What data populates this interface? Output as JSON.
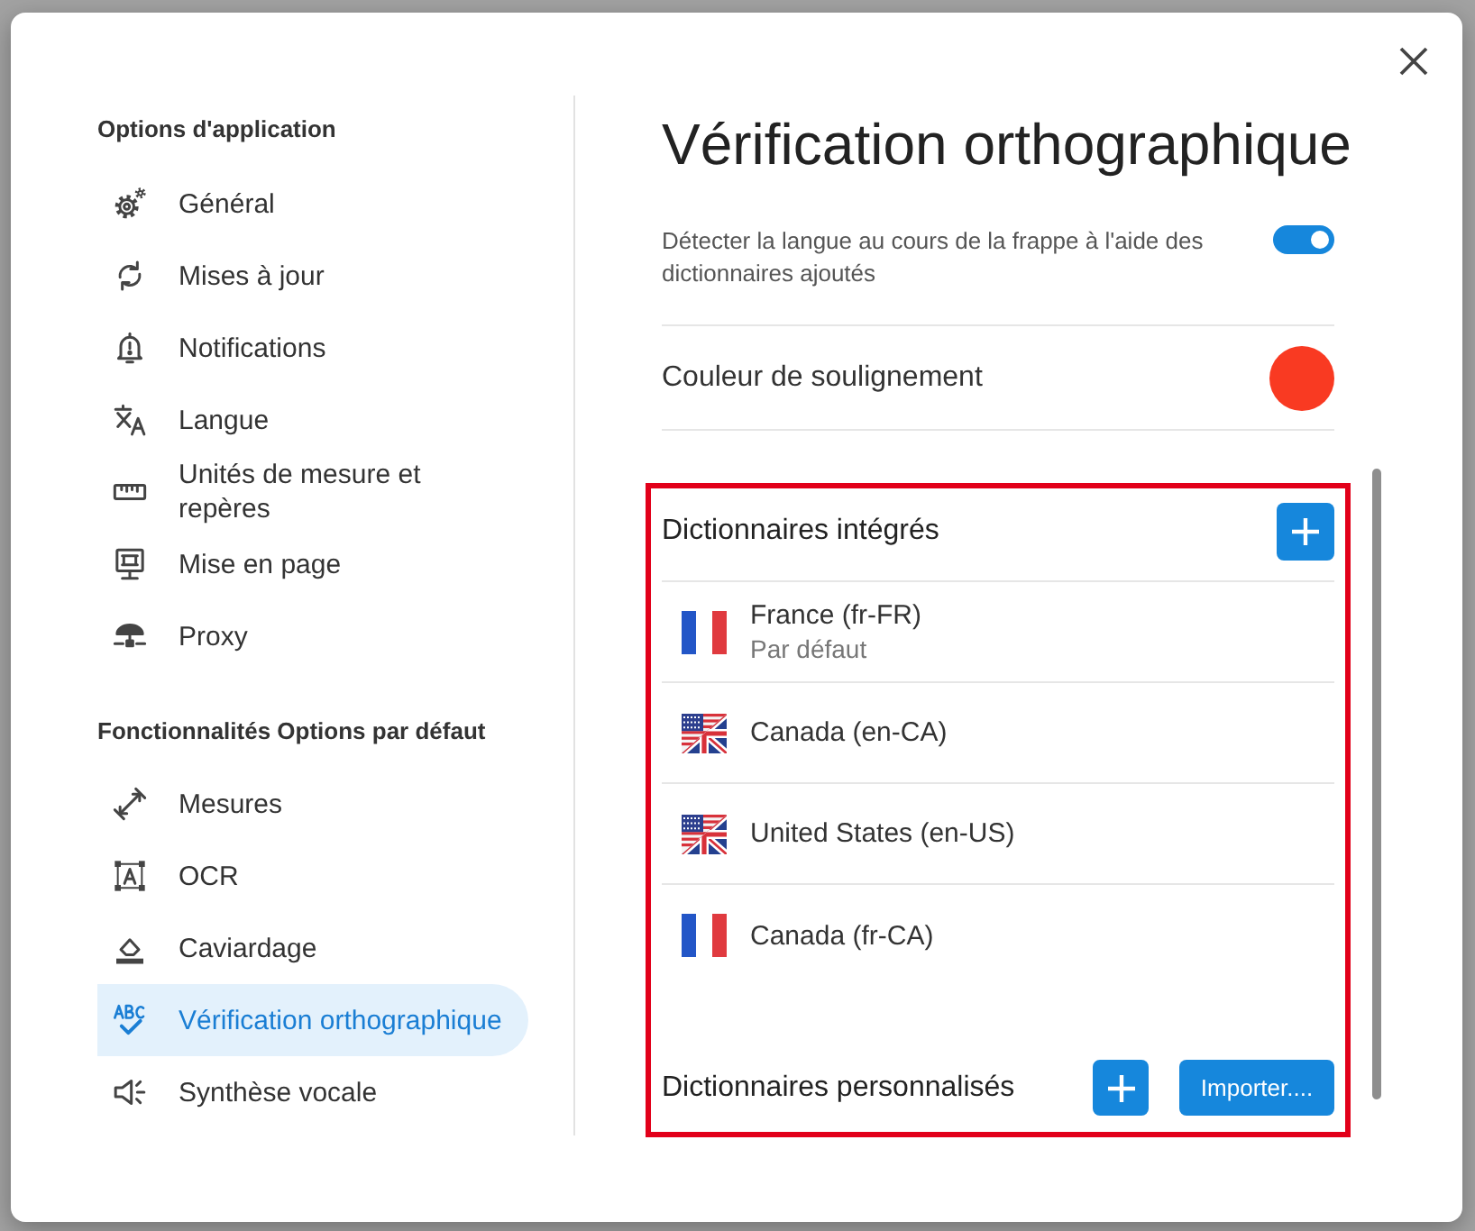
{
  "sidebar": {
    "sections": [
      {
        "title": "Options d'application",
        "items": [
          {
            "label": "Général",
            "selected": false
          },
          {
            "label": "Mises à jour",
            "selected": false
          },
          {
            "label": "Notifications",
            "selected": false
          },
          {
            "label": "Langue",
            "selected": false
          },
          {
            "label": "Unités de mesure et repères",
            "selected": false
          },
          {
            "label": "Mise en page",
            "selected": false
          },
          {
            "label": "Proxy",
            "selected": false
          }
        ]
      },
      {
        "title": "Fonctionnalités Options par défaut",
        "items": [
          {
            "label": "Mesures",
            "selected": false
          },
          {
            "label": "OCR",
            "selected": false
          },
          {
            "label": "Caviardage",
            "selected": false
          },
          {
            "label": "Vérification orthographique",
            "selected": true
          },
          {
            "label": "Synthèse vocale",
            "selected": false
          }
        ]
      }
    ]
  },
  "page_title": "Vérification orthographique",
  "settings": [
    {
      "kind": "toggle",
      "label": "Détecter la langue au cours de la frappe à l'aide des dictionnaires ajoutés",
      "on": true
    },
    {
      "kind": "color",
      "label": "Couleur de soulignement",
      "color": "#f93a22"
    }
  ],
  "dictionaries": {
    "highlighted": true,
    "builtin": {
      "title": "Dictionnaires intégrés",
      "items": [
        {
          "kind": "french",
          "name": "France (fr-FR)",
          "note": "Par défaut"
        },
        {
          "kind": "english",
          "name": "Canada (en-CA)"
        },
        {
          "kind": "english",
          "name": "United States (en-US)"
        },
        {
          "kind": "french",
          "name": "Canada (fr-CA)"
        }
      ]
    },
    "custom": {
      "title": "Dictionnaires personnalisés",
      "import_button": "Importer...."
    }
  }
}
